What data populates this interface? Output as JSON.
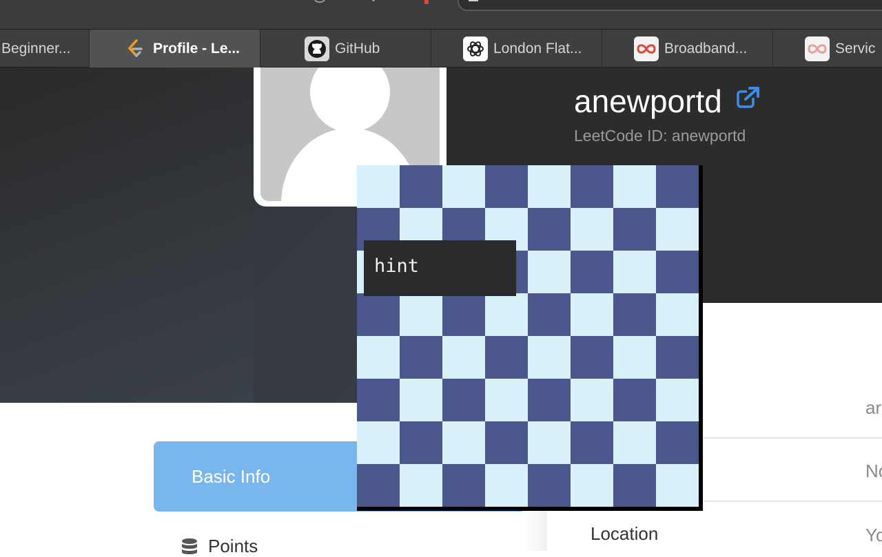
{
  "tabs": [
    {
      "label": "Beginner...",
      "icon": "none",
      "active": false
    },
    {
      "label": "Profile - Le...",
      "icon": "leetcode-icon",
      "active": true
    },
    {
      "label": "GitHub",
      "icon": "github-icon",
      "active": false
    },
    {
      "label": "London Flat...",
      "icon": "openai-icon",
      "active": false
    },
    {
      "label": "Broadband...",
      "icon": "infinity-icon",
      "active": false
    },
    {
      "label": "Servic",
      "icon": "infinity-icon",
      "active": false
    }
  ],
  "profile": {
    "username": "anewportd",
    "leetcode_id": "LeetCode ID: anewportd",
    "avatar": "default-user-avatar"
  },
  "sidebar": {
    "basic_info": "Basic Info",
    "points": "Points"
  },
  "details": {
    "values": [
      "ar",
      "No",
      "Yo"
    ],
    "location_label": "Location"
  },
  "overlay": {
    "hint": "hint",
    "board": {
      "rows": 8,
      "cols": 8,
      "light_color": "#d8f0f9",
      "dark_color": "#4b568d",
      "top_left": "light"
    }
  },
  "colors": {
    "accent": "#79b6ee",
    "link_icon": "#3d8ee8"
  }
}
